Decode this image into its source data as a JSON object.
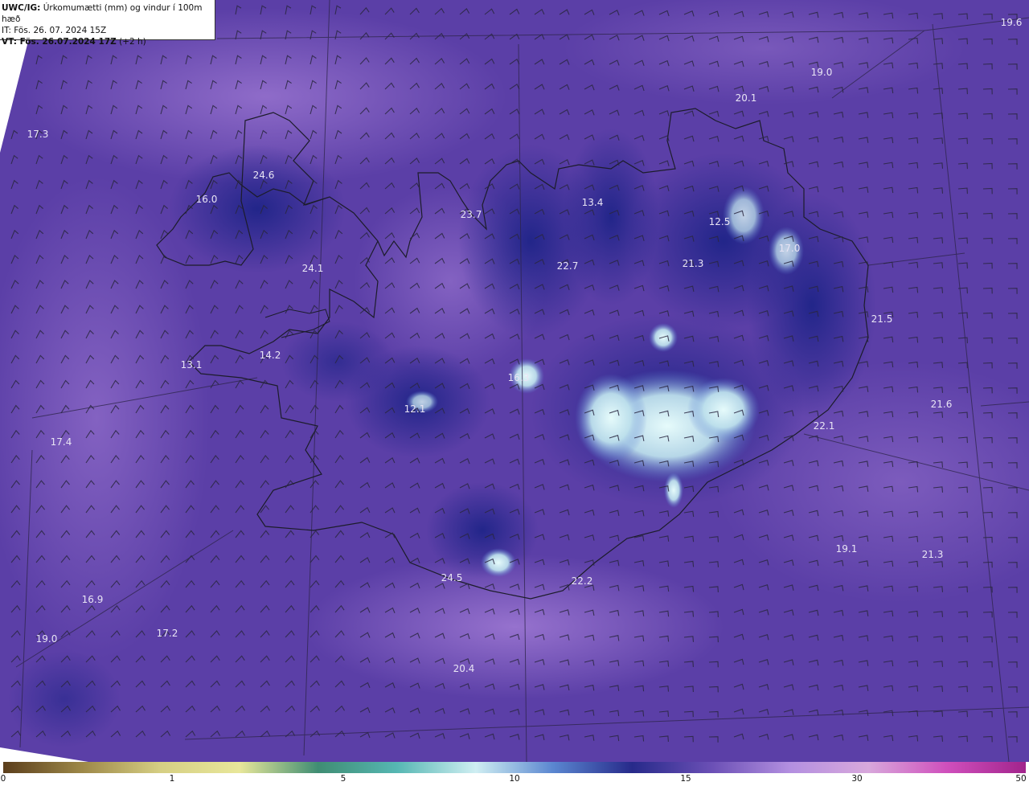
{
  "header": {
    "model": "UWC/IG:",
    "title": "Úrkomumætti (mm) og vindur í 100m hæð",
    "init_prefix": "IT:",
    "init_time": "Fös. 26. 07. 2024 15Z",
    "valid_prefix": "VT:",
    "valid_time": "Fös. 26.07.2024 17Z",
    "valid_offset": "(+2 h)"
  },
  "colors": {
    "base": "#5a3fa6",
    "light": "#9a78cf",
    "dark": "#2b2a8e",
    "peak": "#cfeef2",
    "coast": "#1c1c2a",
    "barb": "#2a2740"
  },
  "values": [
    "19.6",
    "19.0",
    "20.1",
    "17.3",
    "24.6",
    "16.0",
    "23.7",
    "13.4",
    "12.5",
    "17.0",
    "21.3",
    "22.7",
    "24.1",
    "21.5",
    "13.1",
    "14.2",
    "16.3",
    "12.1",
    "21.6",
    "22.1",
    "17.4",
    "19.1",
    "21.3",
    "24.5",
    "22.2",
    "16.9",
    "19.0",
    "17.2",
    "20.4"
  ],
  "colorbar": {
    "ticks": [
      "0",
      "1",
      "5",
      "10",
      "15",
      "30",
      "50"
    ],
    "stops": [
      "#5b3e1c",
      "#9d8848",
      "#d6cf84",
      "#e8e79a",
      "#3f8d73",
      "#56b7b3",
      "#cfeef2",
      "#5a86d0",
      "#272a8a",
      "#6a4fb5",
      "#b38fe0",
      "#d8a8dc",
      "#cf4fbc",
      "#a2248c"
    ]
  }
}
